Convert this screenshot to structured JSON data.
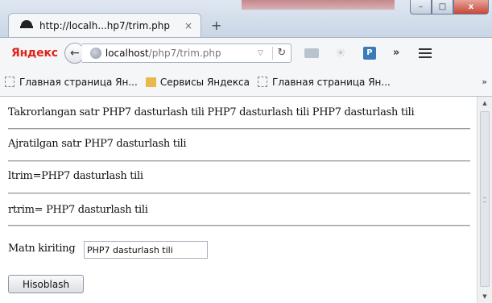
{
  "browser": {
    "tab_title": "http://localh...hp7/trim.php",
    "tab_close": "×",
    "new_tab": "+",
    "window_buttons": {
      "minimize": "–",
      "maximize": "□",
      "close": "x"
    },
    "brand": "Яндекс",
    "url_host": "localhost",
    "url_path": "/php7/trim.php",
    "more": "»",
    "bookmarks": [
      {
        "label": "Главная страница Ян...",
        "icon": "page-icon"
      },
      {
        "label": "Сервисы Яндекса",
        "icon": "folder-icon"
      },
      {
        "label": "Главная страница Ян...",
        "icon": "page-icon"
      }
    ],
    "bookmarks_more": "»"
  },
  "content": {
    "line1": "Takrorlangan satr PHP7 dasturlash tili PHP7 dasturlash tili PHP7 dasturlash tili",
    "line2": "Ajratilgan satr PHP7 dasturlash tili",
    "line3": "ltrim=PHP7 dasturlash tili",
    "line4": "rtrim= PHP7 dasturlash tili",
    "form": {
      "label": "Matn kiriting",
      "input_value": "PHP7 dasturlash tili",
      "button_label": "Hisoblash"
    }
  },
  "colors": {
    "brand_red": "#e0241b",
    "chrome_bg": "#f5f6f7",
    "titlebar": "#c9d6e6"
  }
}
